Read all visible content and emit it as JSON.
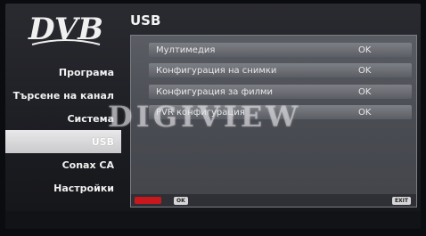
{
  "logo": {
    "text": "DVB"
  },
  "header": {
    "title": "USB"
  },
  "sidebar": {
    "items": [
      {
        "label": "Програма"
      },
      {
        "label": "Търсене на канал"
      },
      {
        "label": "Система"
      },
      {
        "label": "USB",
        "active": true
      },
      {
        "label": "Conax CA"
      },
      {
        "label": "Настройки"
      }
    ]
  },
  "menu": {
    "rows": [
      {
        "label": "Мултимедия",
        "value": "OK"
      },
      {
        "label": "Конфигурация на снимки",
        "value": "OK"
      },
      {
        "label": "Конфигурация за филми",
        "value": "OK"
      },
      {
        "label": "PVR конфигурация",
        "value": "OK"
      }
    ]
  },
  "watermark": "DIGIVIEW",
  "footer": {
    "ok_label": "OK",
    "exit_label": "EXIT"
  },
  "colors": {
    "active_bg": "#dcdcde",
    "panel": "#4d4f56",
    "red_key": "#c8181e"
  }
}
